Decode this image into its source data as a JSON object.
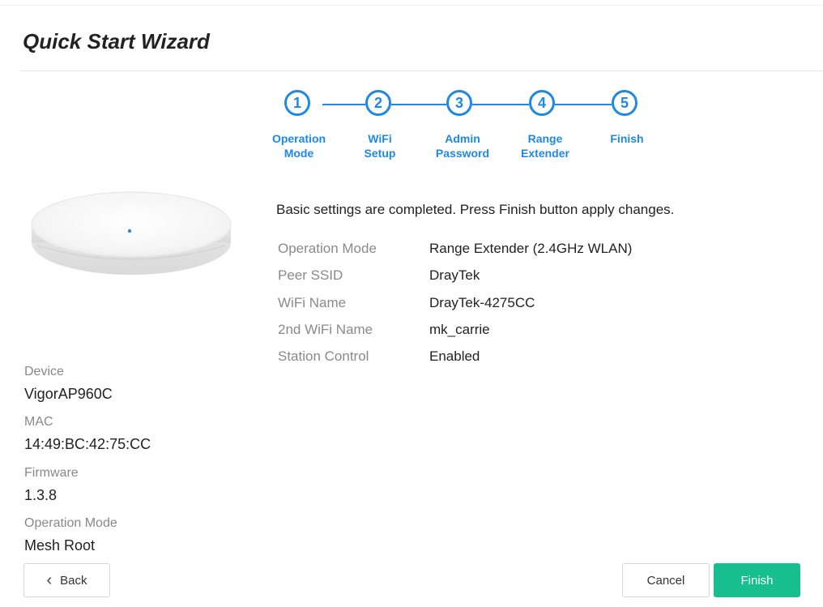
{
  "wizard": {
    "title": "Quick Start Wizard"
  },
  "steps": [
    {
      "number": "1",
      "label_line1": "Operation",
      "label_line2": "Mode"
    },
    {
      "number": "2",
      "label_line1": "WiFi",
      "label_line2": "Setup"
    },
    {
      "number": "3",
      "label_line1": "Admin",
      "label_line2": "Password"
    },
    {
      "number": "4",
      "label_line1": "Range",
      "label_line2": "Extender"
    },
    {
      "number": "5",
      "label_line1": "Finish",
      "label_line2": ""
    }
  ],
  "device_info": {
    "device_label": "Device",
    "device_value": "VigorAP960C",
    "mac_label": "MAC",
    "mac_value": "14:49:BC:42:75:CC",
    "firmware_label": "Firmware",
    "firmware_value": "1.3.8",
    "opmode_label": "Operation Mode",
    "opmode_value": "Mesh Root"
  },
  "summary": {
    "message": "Basic settings are completed. Press Finish button apply changes.",
    "rows": [
      {
        "key": "Operation Mode",
        "value": "Range Extender (2.4GHz WLAN)"
      },
      {
        "key": "Peer SSID",
        "value": "DrayTek"
      },
      {
        "key": "WiFi Name",
        "value": "DrayTek-4275CC"
      },
      {
        "key": "2nd WiFi Name",
        "value": "mk_carrie"
      },
      {
        "key": "Station Control",
        "value": "Enabled"
      }
    ]
  },
  "buttons": {
    "back": "Back",
    "cancel": "Cancel",
    "finish": "Finish"
  },
  "icons": {
    "back": "chevron-left-icon",
    "device": "access-point-device-image"
  },
  "colors": {
    "accent": "#1E88E5",
    "finish": "#17BE8E"
  }
}
